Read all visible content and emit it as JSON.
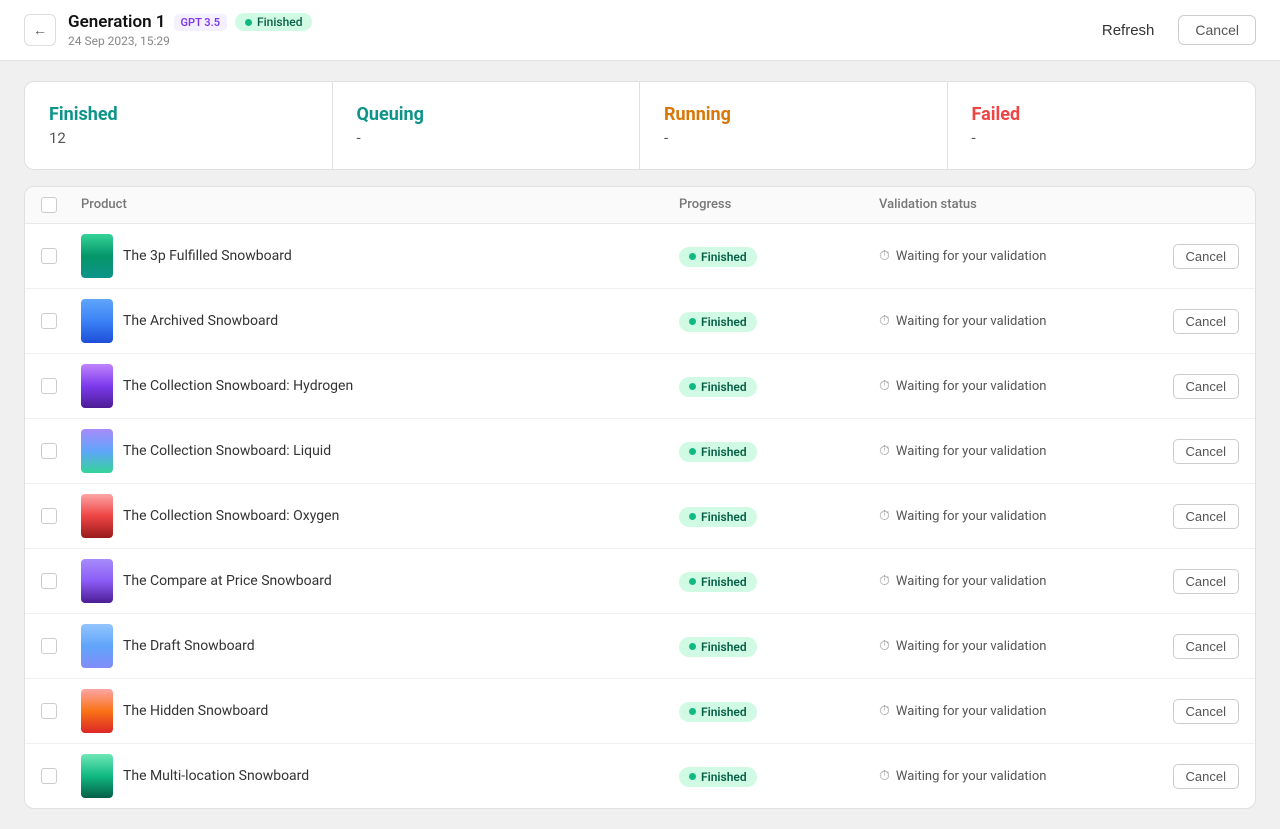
{
  "header": {
    "back_label": "←",
    "title": "Generation 1",
    "gpt_badge": "GPT 3.5",
    "status_badge": "Finished",
    "date": "24 Sep 2023, 15:29",
    "refresh_label": "Refresh",
    "cancel_label": "Cancel"
  },
  "stats": {
    "finished": {
      "label": "Finished",
      "value": "12"
    },
    "queuing": {
      "label": "Queuing",
      "value": "-"
    },
    "running": {
      "label": "Running",
      "value": "-"
    },
    "failed": {
      "label": "Failed",
      "value": "-"
    }
  },
  "table": {
    "columns": [
      "Product",
      "Progress",
      "Validation status",
      ""
    ],
    "rows": [
      {
        "name": "The 3p Fulfilled Snowboard",
        "progress": "Finished",
        "validation": "Waiting for your validation",
        "thumb_class": "green"
      },
      {
        "name": "The Archived Snowboard",
        "progress": "Finished",
        "validation": "Waiting for your validation",
        "thumb_class": "blue"
      },
      {
        "name": "The Collection Snowboard: Hydrogen",
        "progress": "Finished",
        "validation": "Waiting for your validation",
        "thumb_class": "purple"
      },
      {
        "name": "The Collection Snowboard: Liquid",
        "progress": "Finished",
        "validation": "Waiting for your validation",
        "thumb_class": "liquid"
      },
      {
        "name": "The Collection Snowboard: Oxygen",
        "progress": "Finished",
        "validation": "Waiting for your validation",
        "thumb_class": "red"
      },
      {
        "name": "The Compare at Price Snowboard",
        "progress": "Finished",
        "validation": "Waiting for your validation",
        "thumb_class": "compare"
      },
      {
        "name": "The Draft Snowboard",
        "progress": "Finished",
        "validation": "Waiting for your validation",
        "thumb_class": "draft"
      },
      {
        "name": "The Hidden Snowboard",
        "progress": "Finished",
        "validation": "Waiting for your validation",
        "thumb_class": "hidden"
      },
      {
        "name": "The Multi-location Snowboard",
        "progress": "Finished",
        "validation": "Waiting for your validation",
        "thumb_class": "multiloc"
      }
    ],
    "cancel_label": "Cancel"
  }
}
